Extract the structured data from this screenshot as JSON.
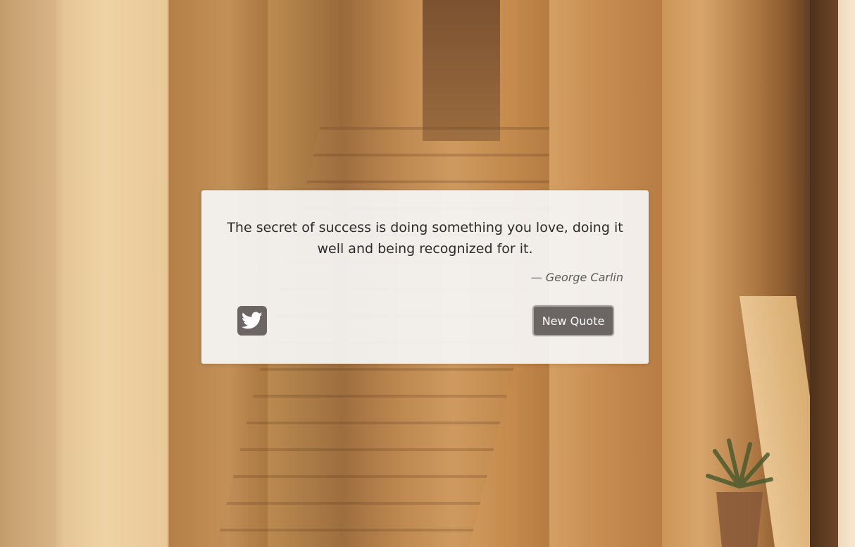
{
  "quote": {
    "text": "The secret of success is doing something you love, doing it well and being recognized for it.",
    "author": "— George Carlin"
  },
  "actions": {
    "tweet_icon": "twitter-icon",
    "new_quote_label": "New Quote"
  },
  "colors": {
    "card_background": "#f5f5f5",
    "button_background": "#6b6663",
    "button_border": "#a8a4a1",
    "quote_text": "#2b2b2b",
    "author_text": "#5a5a5a"
  }
}
